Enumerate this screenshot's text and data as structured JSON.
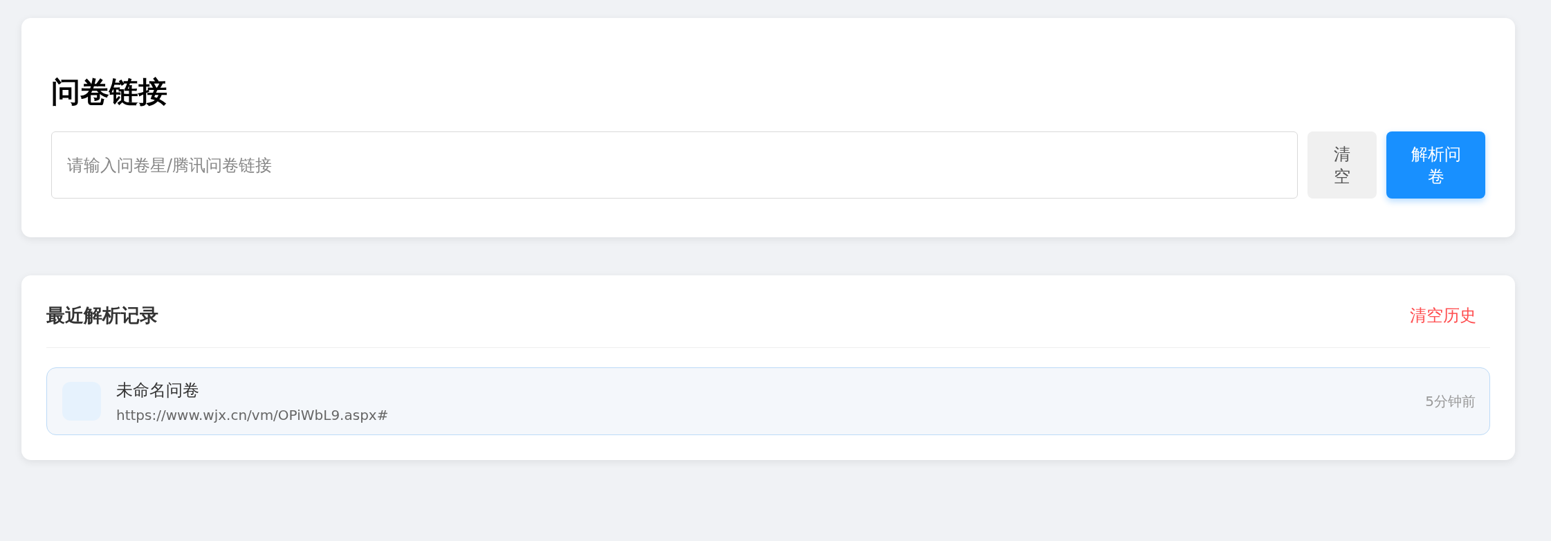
{
  "link_card": {
    "title": "问卷链接",
    "input": {
      "placeholder": "请输入问卷星/腾讯问卷链接"
    },
    "buttons": [
      {
        "kind": "secondary",
        "label": "清空"
      },
      {
        "kind": "primary",
        "label": "解析问卷"
      }
    ]
  },
  "history": {
    "title": "最近解析记录",
    "clear_label": "清空历史",
    "items": [
      {
        "name": "未命名问卷",
        "url": "https://www.wjx.cn/vm/OPiWbL9.aspx#",
        "time": "5分钟前"
      }
    ]
  }
}
